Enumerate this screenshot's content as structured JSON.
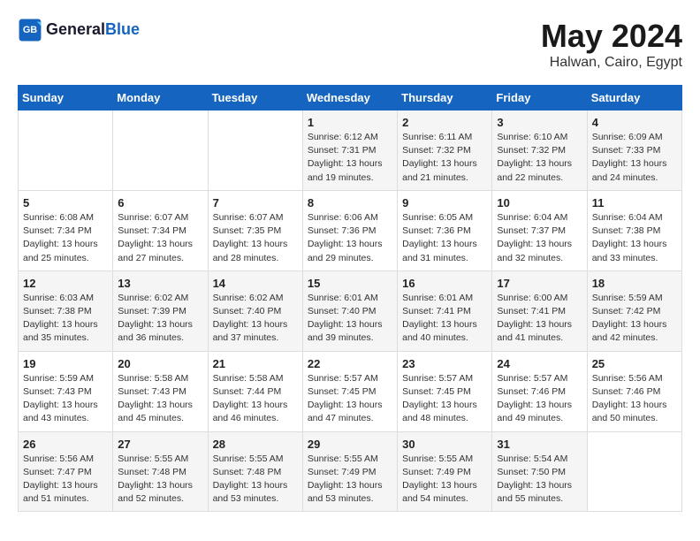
{
  "header": {
    "logo_general": "General",
    "logo_blue": "Blue",
    "month_title": "May 2024",
    "location": "Halwan, Cairo, Egypt"
  },
  "weekdays": [
    "Sunday",
    "Monday",
    "Tuesday",
    "Wednesday",
    "Thursday",
    "Friday",
    "Saturday"
  ],
  "weeks": [
    [
      {
        "day": "",
        "info": ""
      },
      {
        "day": "",
        "info": ""
      },
      {
        "day": "",
        "info": ""
      },
      {
        "day": "1",
        "info": "Sunrise: 6:12 AM\nSunset: 7:31 PM\nDaylight: 13 hours\nand 19 minutes."
      },
      {
        "day": "2",
        "info": "Sunrise: 6:11 AM\nSunset: 7:32 PM\nDaylight: 13 hours\nand 21 minutes."
      },
      {
        "day": "3",
        "info": "Sunrise: 6:10 AM\nSunset: 7:32 PM\nDaylight: 13 hours\nand 22 minutes."
      },
      {
        "day": "4",
        "info": "Sunrise: 6:09 AM\nSunset: 7:33 PM\nDaylight: 13 hours\nand 24 minutes."
      }
    ],
    [
      {
        "day": "5",
        "info": "Sunrise: 6:08 AM\nSunset: 7:34 PM\nDaylight: 13 hours\nand 25 minutes."
      },
      {
        "day": "6",
        "info": "Sunrise: 6:07 AM\nSunset: 7:34 PM\nDaylight: 13 hours\nand 27 minutes."
      },
      {
        "day": "7",
        "info": "Sunrise: 6:07 AM\nSunset: 7:35 PM\nDaylight: 13 hours\nand 28 minutes."
      },
      {
        "day": "8",
        "info": "Sunrise: 6:06 AM\nSunset: 7:36 PM\nDaylight: 13 hours\nand 29 minutes."
      },
      {
        "day": "9",
        "info": "Sunrise: 6:05 AM\nSunset: 7:36 PM\nDaylight: 13 hours\nand 31 minutes."
      },
      {
        "day": "10",
        "info": "Sunrise: 6:04 AM\nSunset: 7:37 PM\nDaylight: 13 hours\nand 32 minutes."
      },
      {
        "day": "11",
        "info": "Sunrise: 6:04 AM\nSunset: 7:38 PM\nDaylight: 13 hours\nand 33 minutes."
      }
    ],
    [
      {
        "day": "12",
        "info": "Sunrise: 6:03 AM\nSunset: 7:38 PM\nDaylight: 13 hours\nand 35 minutes."
      },
      {
        "day": "13",
        "info": "Sunrise: 6:02 AM\nSunset: 7:39 PM\nDaylight: 13 hours\nand 36 minutes."
      },
      {
        "day": "14",
        "info": "Sunrise: 6:02 AM\nSunset: 7:40 PM\nDaylight: 13 hours\nand 37 minutes."
      },
      {
        "day": "15",
        "info": "Sunrise: 6:01 AM\nSunset: 7:40 PM\nDaylight: 13 hours\nand 39 minutes."
      },
      {
        "day": "16",
        "info": "Sunrise: 6:01 AM\nSunset: 7:41 PM\nDaylight: 13 hours\nand 40 minutes."
      },
      {
        "day": "17",
        "info": "Sunrise: 6:00 AM\nSunset: 7:41 PM\nDaylight: 13 hours\nand 41 minutes."
      },
      {
        "day": "18",
        "info": "Sunrise: 5:59 AM\nSunset: 7:42 PM\nDaylight: 13 hours\nand 42 minutes."
      }
    ],
    [
      {
        "day": "19",
        "info": "Sunrise: 5:59 AM\nSunset: 7:43 PM\nDaylight: 13 hours\nand 43 minutes."
      },
      {
        "day": "20",
        "info": "Sunrise: 5:58 AM\nSunset: 7:43 PM\nDaylight: 13 hours\nand 45 minutes."
      },
      {
        "day": "21",
        "info": "Sunrise: 5:58 AM\nSunset: 7:44 PM\nDaylight: 13 hours\nand 46 minutes."
      },
      {
        "day": "22",
        "info": "Sunrise: 5:57 AM\nSunset: 7:45 PM\nDaylight: 13 hours\nand 47 minutes."
      },
      {
        "day": "23",
        "info": "Sunrise: 5:57 AM\nSunset: 7:45 PM\nDaylight: 13 hours\nand 48 minutes."
      },
      {
        "day": "24",
        "info": "Sunrise: 5:57 AM\nSunset: 7:46 PM\nDaylight: 13 hours\nand 49 minutes."
      },
      {
        "day": "25",
        "info": "Sunrise: 5:56 AM\nSunset: 7:46 PM\nDaylight: 13 hours\nand 50 minutes."
      }
    ],
    [
      {
        "day": "26",
        "info": "Sunrise: 5:56 AM\nSunset: 7:47 PM\nDaylight: 13 hours\nand 51 minutes."
      },
      {
        "day": "27",
        "info": "Sunrise: 5:55 AM\nSunset: 7:48 PM\nDaylight: 13 hours\nand 52 minutes."
      },
      {
        "day": "28",
        "info": "Sunrise: 5:55 AM\nSunset: 7:48 PM\nDaylight: 13 hours\nand 53 minutes."
      },
      {
        "day": "29",
        "info": "Sunrise: 5:55 AM\nSunset: 7:49 PM\nDaylight: 13 hours\nand 53 minutes."
      },
      {
        "day": "30",
        "info": "Sunrise: 5:55 AM\nSunset: 7:49 PM\nDaylight: 13 hours\nand 54 minutes."
      },
      {
        "day": "31",
        "info": "Sunrise: 5:54 AM\nSunset: 7:50 PM\nDaylight: 13 hours\nand 55 minutes."
      },
      {
        "day": "",
        "info": ""
      }
    ]
  ]
}
